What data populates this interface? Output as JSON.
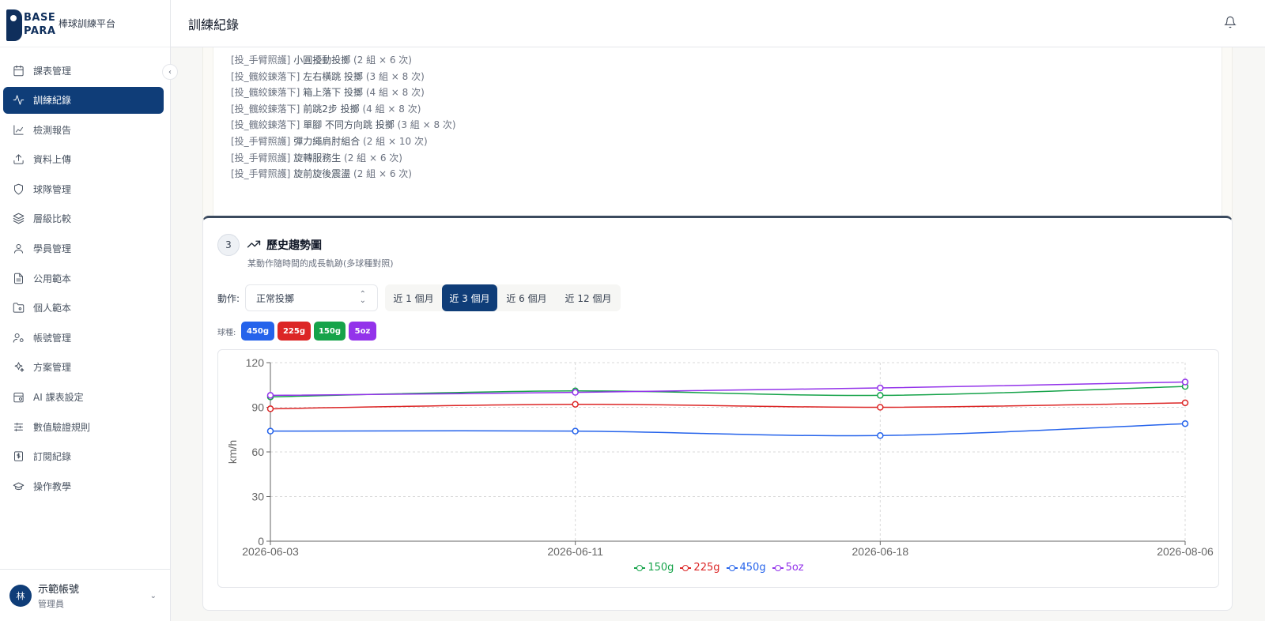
{
  "brand": {
    "logo_line1": "BASE",
    "logo_line2": "PARA",
    "name": "棒球訓練平台"
  },
  "header": {
    "title": "訓練紀錄"
  },
  "sidebar": {
    "items": [
      {
        "label": "課表管理",
        "icon": "calendar-icon"
      },
      {
        "label": "訓練紀錄",
        "icon": "activity-icon",
        "active": true
      },
      {
        "label": "檢測報告",
        "icon": "line-chart-icon"
      },
      {
        "label": "資料上傳",
        "icon": "upload-icon"
      },
      {
        "label": "球隊管理",
        "icon": "shield-icon"
      },
      {
        "label": "層級比較",
        "icon": "layers-icon"
      },
      {
        "label": "學員管理",
        "icon": "user-icon"
      },
      {
        "label": "公用範本",
        "icon": "file-text-icon"
      },
      {
        "label": "個人範本",
        "icon": "folder-icon"
      },
      {
        "label": "帳號管理",
        "icon": "user-cog-icon"
      },
      {
        "label": "方案管理",
        "icon": "sparkles-icon"
      },
      {
        "label": "AI 課表設定",
        "icon": "calendar-cog-icon"
      },
      {
        "label": "數值驗證規則",
        "icon": "sliders-icon"
      },
      {
        "label": "訂閱紀錄",
        "icon": "receipt-icon"
      },
      {
        "label": "操作教學",
        "icon": "graduation-cap-icon"
      }
    ]
  },
  "user": {
    "avatar": "林",
    "name": "示範帳號",
    "role": "管理員"
  },
  "exercises": [
    {
      "tag": "[投_手臂照護]",
      "name": "小圓擾動投擲",
      "count": "(2 組 × 6 次)"
    },
    {
      "tag": "[投_髖絞鍊落下]",
      "name": "左右橫跳 投擲",
      "count": "(3 組 × 8 次)"
    },
    {
      "tag": "[投_髖絞鍊落下]",
      "name": "箱上落下 投擲",
      "count": "(4 組 × 8 次)"
    },
    {
      "tag": "[投_髖絞鍊落下]",
      "name": "前跳2步 投擲",
      "count": "(4 組 × 8 次)"
    },
    {
      "tag": "[投_髖絞鍊落下]",
      "name": "單腳 不同方向跳 投擲",
      "count": "(3 組 × 8 次)"
    },
    {
      "tag": "[投_手臂照護]",
      "name": "彈力繩肩肘組合",
      "count": "(2 組 × 10 次)"
    },
    {
      "tag": "[投_手臂照護]",
      "name": "旋轉服務生",
      "count": "(2 組 × 6 次)"
    },
    {
      "tag": "[投_手臂照護]",
      "name": "旋前旋後震盪",
      "count": "(2 組 × 6 次)"
    }
  ],
  "trend": {
    "step": "3",
    "title": "歷史趨勢圖",
    "subtitle": "某動作隨時間的成長軌跡(多球種對照)",
    "action_label": "動作:",
    "action_value": "正常投擲",
    "ranges": [
      {
        "label": "近 1 個月"
      },
      {
        "label": "近 3 個月",
        "active": true
      },
      {
        "label": "近 6 個月"
      },
      {
        "label": "近 12 個月"
      }
    ],
    "ball_label": "球種:",
    "balls": [
      {
        "label": "450g",
        "color": "#2563eb"
      },
      {
        "label": "225g",
        "color": "#dc2626"
      },
      {
        "label": "150g",
        "color": "#16a34a"
      },
      {
        "label": "5oz",
        "color": "#9333ea"
      }
    ]
  },
  "chart_data": {
    "type": "line",
    "x": [
      "2026-06-03",
      "2026-06-11",
      "2026-06-18",
      "2026-08-06"
    ],
    "ylabel": "km/h",
    "xlabel": "",
    "ylim": [
      0,
      120
    ],
    "yticks": [
      0,
      30,
      60,
      90,
      120
    ],
    "grid": true,
    "legend_placement": "bottom",
    "series": [
      {
        "name": "150g",
        "color": "#16a34a",
        "values": [
          97,
          101,
          98,
          104
        ]
      },
      {
        "name": "225g",
        "color": "#dc2626",
        "values": [
          89,
          92,
          90,
          93
        ]
      },
      {
        "name": "450g",
        "color": "#2563eb",
        "values": [
          74,
          74,
          71,
          79
        ]
      },
      {
        "name": "5oz",
        "color": "#9333ea",
        "values": [
          98,
          100,
          103,
          107
        ]
      }
    ]
  }
}
